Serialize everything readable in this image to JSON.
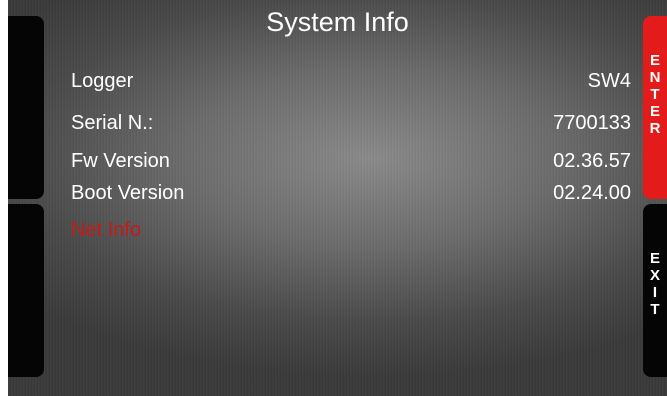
{
  "title": "System Info",
  "rows": [
    {
      "label": "Logger",
      "value": "SW4"
    },
    {
      "label": "Serial N.:",
      "value": "7700133"
    },
    {
      "label": "Fw Version",
      "value": "02.36.57"
    },
    {
      "label": "Boot Version",
      "value": "02.24.00"
    }
  ],
  "net_info_label": "Net Info",
  "buttons": {
    "enter": "ENTER",
    "exit": "EXIT"
  },
  "colors": {
    "accent_red": "#e31b1b",
    "net_info_red": "#c41a1a",
    "side_black": "#050505"
  }
}
